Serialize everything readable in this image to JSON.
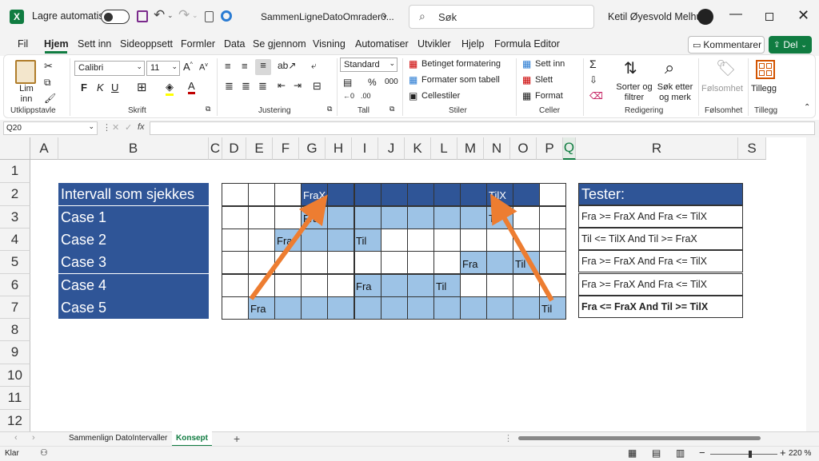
{
  "titlebar": {
    "autosave_label": "Lagre automatisk",
    "filename": "SammenLigneDatoOmrader0...",
    "search_placeholder": "Søk",
    "user_name": "Ketil Øyesvold Melhus"
  },
  "ribbon_tabs": [
    "Fil",
    "Hjem",
    "Sett inn",
    "Sideoppsett",
    "Formler",
    "Data",
    "Se gjennom",
    "Visning",
    "Automatiser",
    "Utvikler",
    "Hjelp",
    "Formula Editor"
  ],
  "comments_label": "Kommentarer",
  "share_label": "Del",
  "clipboard": {
    "paste": "Lim inn",
    "group": "Utklippstavle"
  },
  "font": {
    "name": "Calibri",
    "size": "11",
    "bold": "F",
    "italic": "K",
    "underline": "U",
    "group": "Skrift"
  },
  "alignment": {
    "group": "Justering"
  },
  "number": {
    "format": "Standard",
    "group": "Tall"
  },
  "styles": {
    "conditional": "Betinget formatering",
    "as_table": "Formater som tabell",
    "cell_styles": "Cellestiler",
    "group": "Stiler"
  },
  "cells": {
    "insert": "Sett inn",
    "delete": "Slett",
    "format": "Format",
    "group": "Celler"
  },
  "editing": {
    "sort": "Sorter og filtrer",
    "find": "Søk etter og merk",
    "group": "Redigering"
  },
  "sensitivity": {
    "label": "Følsomhet",
    "group": "Følsomhet"
  },
  "addins": {
    "label": "Tillegg",
    "group": "Tillegg"
  },
  "namebox": "Q20",
  "fx": "fx",
  "columns": [
    "A",
    "B",
    "C",
    "D",
    "E",
    "F",
    "G",
    "H",
    "I",
    "J",
    "K",
    "L",
    "M",
    "N",
    "O",
    "P",
    "Q",
    "R",
    "S"
  ],
  "rows": [
    "1",
    "2",
    "3",
    "4",
    "5",
    "6",
    "7",
    "8",
    "9",
    "10",
    "11",
    "12"
  ],
  "case_table": {
    "header": "Intervall som sjekkes",
    "rows": [
      "Case 1",
      "Case 2",
      "Case 3",
      "Case 4",
      "Case 5"
    ]
  },
  "timeline": {
    "frax": "FraX",
    "tilx": "TilX",
    "fra": "Fra",
    "til": "Til",
    "fill_color": "#9dc3e6",
    "header_color": "#2f5597",
    "arrow_color": "#ed7d31"
  },
  "tests": {
    "header": "Tester:",
    "rows": [
      "Fra >= FraX And Fra <= TilX",
      "Til <= TilX And Til >= FraX",
      "Fra >= FraX And Fra <= TilX",
      "Fra >= FraX And Fra <= TilX",
      "Fra <= FraX And Til >= TilX"
    ]
  },
  "sheets": [
    "Sammenlign DatoIntervaller",
    "Konsept"
  ],
  "status": {
    "ready": "Klar",
    "zoom": "220 %"
  }
}
